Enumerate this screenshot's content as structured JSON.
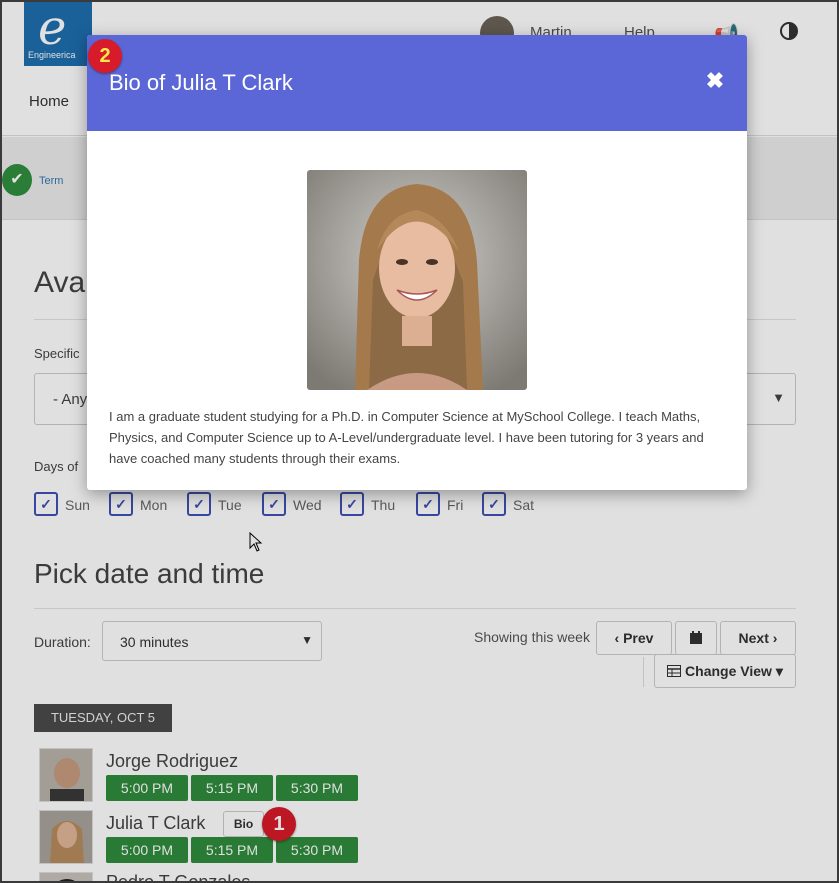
{
  "header": {
    "logo_text": "Engineerica",
    "user_name": "Martin",
    "help_label": "Help",
    "nav_home": "Home"
  },
  "steps": {
    "term_label": "Term"
  },
  "availability": {
    "heading": "Avai",
    "specific_label": "Specific",
    "specific_value": "- Any",
    "days_label": "Days of",
    "days": [
      {
        "label": "Sun",
        "checked": true
      },
      {
        "label": "Mon",
        "checked": true
      },
      {
        "label": "Tue",
        "checked": true
      },
      {
        "label": "Wed",
        "checked": true
      },
      {
        "label": "Thu",
        "checked": true
      },
      {
        "label": "Fri",
        "checked": true
      },
      {
        "label": "Sat",
        "checked": true
      }
    ]
  },
  "pick": {
    "heading": "Pick date and time",
    "duration_label": "Duration:",
    "duration_value": "30 minutes",
    "showing_label": "Showing this week",
    "prev_label": "Prev",
    "next_label": "Next",
    "change_view_label": "Change View",
    "date_chip": "TUESDAY, OCT 5"
  },
  "tutors": [
    {
      "name": "Jorge Rodriguez",
      "slots": [
        "5:00 PM",
        "5:15 PM",
        "5:30 PM"
      ]
    },
    {
      "name": "Julia T Clark",
      "bio_label": "Bio",
      "slots": [
        "5:00 PM",
        "5:15 PM",
        "5:30 PM"
      ]
    },
    {
      "name": "Pedro T Gonzales"
    }
  ],
  "badges": {
    "one": "1",
    "two": "2"
  },
  "modal": {
    "title": "Bio of Julia T Clark",
    "close_glyph": "✖",
    "bio": "I am a graduate student studying for a Ph.D. in Computer Science at MySchool College. I teach Maths, Physics, and Computer Science up to A-Level/undergraduate level. I have been tutoring for 3 years and have coached many students through their exams."
  },
  "colors": {
    "modal_header": "#5b67d6",
    "slot_green": "#2e8b3c",
    "checkbox_blue": "#3f51b5",
    "badge_red": "#d81b2a"
  }
}
